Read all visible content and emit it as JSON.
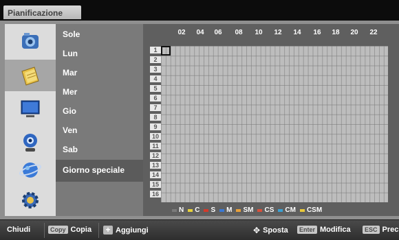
{
  "window": {
    "title": "Pianificazione"
  },
  "sidebar_icons": [
    {
      "name": "camera-icon"
    },
    {
      "name": "calendar-icon"
    },
    {
      "name": "monitor-icon"
    },
    {
      "name": "webcam-icon"
    },
    {
      "name": "network-globe-icon"
    },
    {
      "name": "gear-icon"
    }
  ],
  "days": [
    "Sole",
    "Lun",
    "Mar",
    "Mer",
    "Gio",
    "Ven",
    "Sab",
    "Giorno speciale"
  ],
  "selected_day": "Giorno speciale",
  "hours": [
    "02",
    "04",
    "06",
    "08",
    "10",
    "12",
    "14",
    "16",
    "18",
    "20",
    "22"
  ],
  "rows": [
    "1",
    "2",
    "3",
    "4",
    "5",
    "6",
    "7",
    "8",
    "9",
    "10",
    "11",
    "12",
    "13",
    "14",
    "15",
    "16"
  ],
  "legend": [
    {
      "label": "N",
      "color": "#7a7a7a"
    },
    {
      "label": "C",
      "color": "#e8d23a"
    },
    {
      "label": "S",
      "color": "#d23a2a"
    },
    {
      "label": "M",
      "color": "#3a78d2"
    },
    {
      "label": "SM",
      "color": "#e8a03a"
    },
    {
      "label": "CS",
      "color": "#d8503a"
    },
    {
      "label": "CM",
      "color": "#3aa0d2"
    },
    {
      "label": "CSM",
      "color": "#e8c83a"
    }
  ],
  "bottom": {
    "close": "Chiudi",
    "copy_key": "Copy",
    "copy": "Copia",
    "add": "Aggiungi",
    "move": "Sposta",
    "enter_key": "Enter",
    "modify": "Modifica",
    "esc_key": "ESC",
    "prev": "Prec."
  }
}
